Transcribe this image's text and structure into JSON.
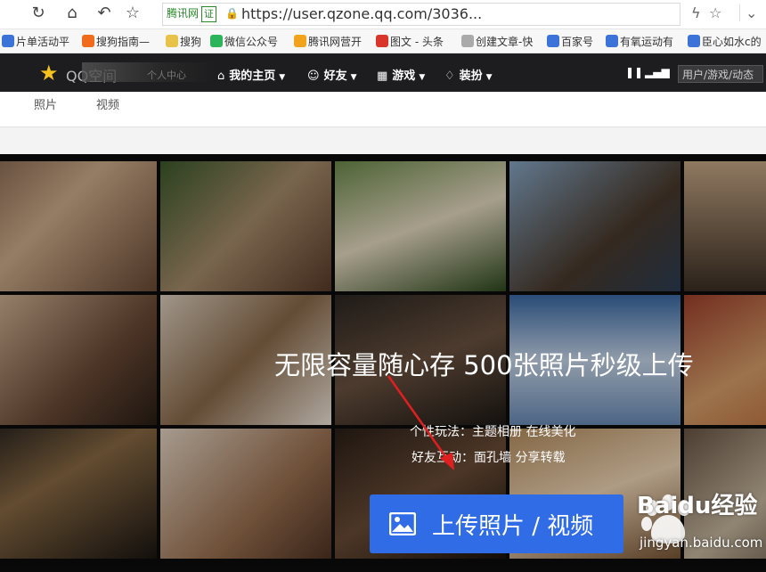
{
  "browser": {
    "cert_label": "腾讯网",
    "cert_badge": "证",
    "url": "https://user.qzone.qq.com/3036...",
    "bookmarks": [
      {
        "label": "片单活动平",
        "color": "#3b73d9"
      },
      {
        "label": "搜狗指南—",
        "color": "#f06b1b"
      },
      {
        "label": "搜狗",
        "color": "#e8c34a"
      },
      {
        "label": "微信公众号",
        "color": "#2cb45a"
      },
      {
        "label": "腾讯网营开",
        "color": "#f2a31b"
      },
      {
        "label": "图文 - 头条",
        "color": "#d9352b"
      },
      {
        "label": "创建文章-快",
        "color": "#aaaaaa"
      },
      {
        "label": "百家号",
        "color": "#3b73d9"
      },
      {
        "label": "有氧运动有",
        "color": "#3b73d9"
      },
      {
        "label": "臣心如水c的",
        "color": "#3b73d9"
      }
    ]
  },
  "qzone_nav": {
    "logo_text": "QQ空间",
    "home_prefix": "个人中心",
    "items": [
      {
        "label": "我的主页",
        "icon": "home-icon"
      },
      {
        "label": "好友",
        "icon": "friends-icon"
      },
      {
        "label": "游戏",
        "icon": "games-icon"
      },
      {
        "label": "装扮",
        "icon": "outfit-icon"
      }
    ],
    "search_placeholder": "用户/游戏/动态"
  },
  "subtabs": [
    "照片",
    "视频"
  ],
  "hero": {
    "title": "无限容量随心存 500张照片秒级上传",
    "features": [
      "个性玩法：主题相册 在线美化",
      "好友互动：面孔墙   分享转载"
    ],
    "upload_label": "上传照片 / 视频",
    "accent": "#2f6ce6"
  },
  "watermark": {
    "text": "Baidu经验",
    "url": "jingyan.baidu.com"
  }
}
